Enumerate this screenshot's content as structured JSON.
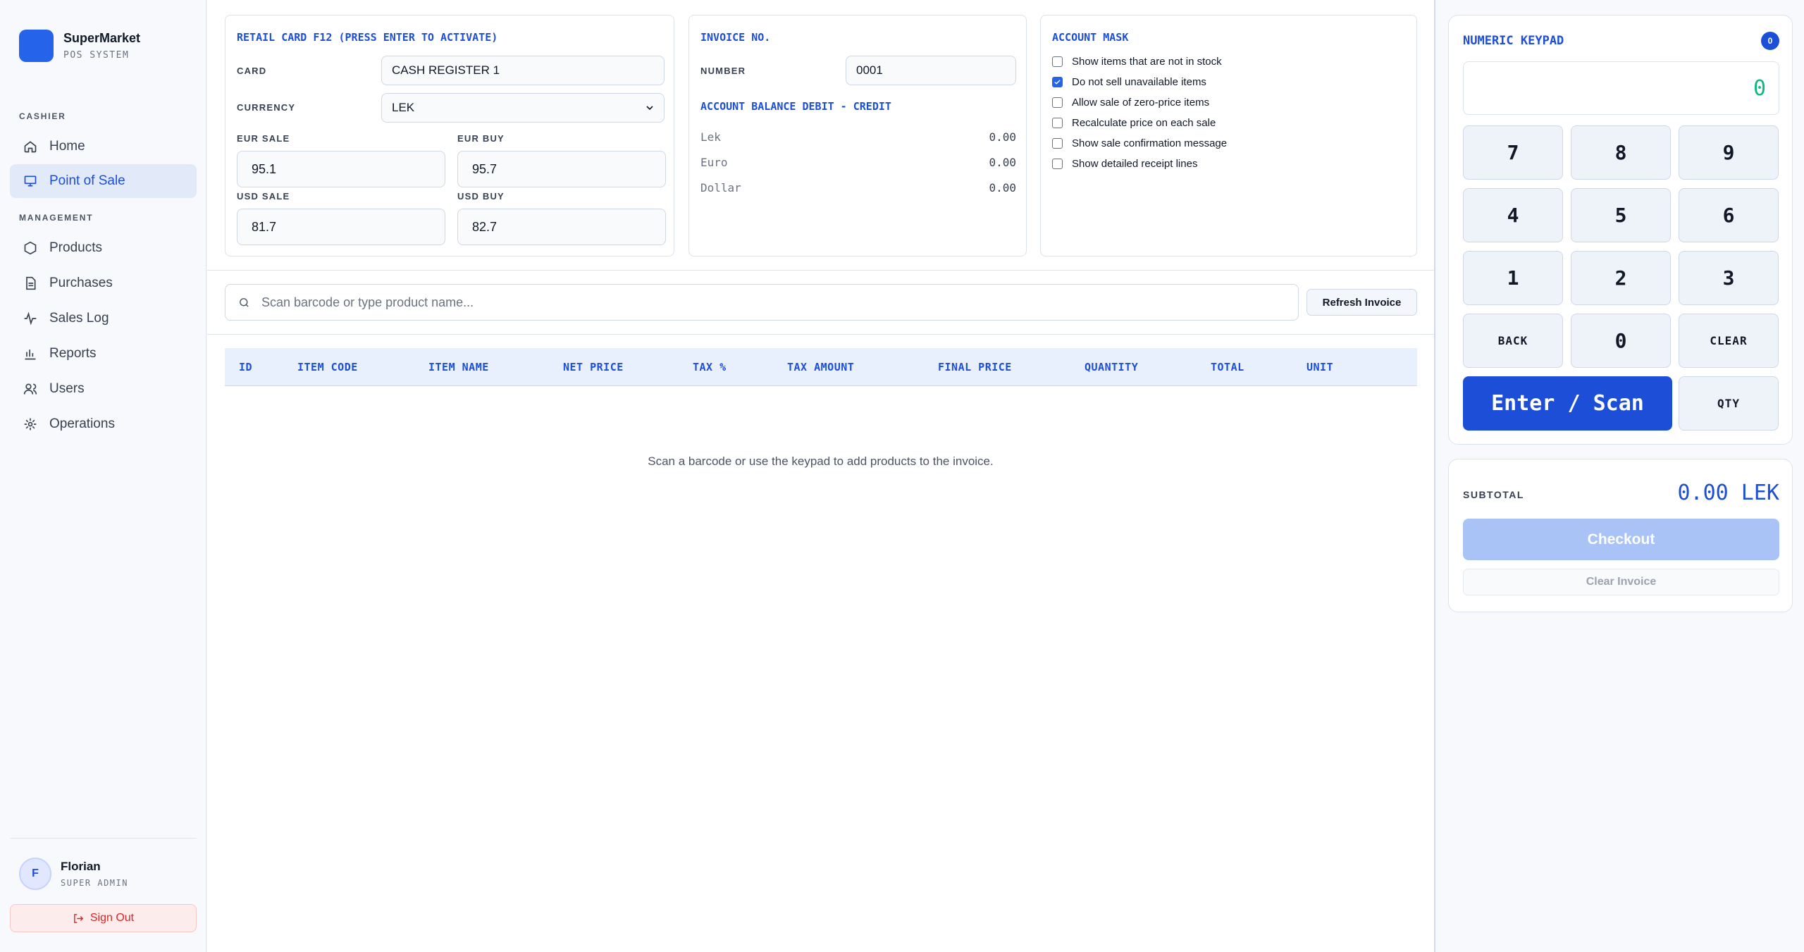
{
  "brand": {
    "name": "SuperMarket",
    "subtitle": "POS SYSTEM"
  },
  "sidebar": {
    "cashier_section": "CASHIER",
    "management_section": "MANAGEMENT",
    "items": [
      {
        "label": "Home",
        "icon": "home-icon"
      },
      {
        "label": "Point of Sale",
        "icon": "monitor-icon",
        "active": true
      },
      {
        "label": "Products",
        "icon": "box-icon"
      },
      {
        "label": "Purchases",
        "icon": "document-icon"
      },
      {
        "label": "Sales Log",
        "icon": "activity-icon"
      },
      {
        "label": "Reports",
        "icon": "bar-chart-icon"
      },
      {
        "label": "Users",
        "icon": "users-icon"
      },
      {
        "label": "Operations",
        "icon": "sun-icon"
      }
    ],
    "user": {
      "initial": "F",
      "name": "Florian",
      "role": "SUPER ADMIN"
    },
    "sign_out": "Sign Out"
  },
  "retail_card": {
    "title": "RETAIL CARD F12 (PRESS ENTER TO ACTIVATE)",
    "card_label": "CARD",
    "card_value": "CASH REGISTER 1",
    "currency_label": "CURRENCY",
    "currency_value": "LEK",
    "eur_sale_label": "EUR SALE",
    "eur_sale": "95.1",
    "eur_buy_label": "EUR BUY",
    "eur_buy": "95.7",
    "usd_sale_label": "USD SALE",
    "usd_sale": "81.7",
    "usd_buy_label": "USD BUY",
    "usd_buy": "82.7"
  },
  "invoice": {
    "title": "INVOICE NO.",
    "number_label": "NUMBER",
    "number_value": "0001",
    "balance_title": "ACCOUNT BALANCE DEBIT - CREDIT",
    "balances": [
      {
        "name": "Lek",
        "value": "0.00"
      },
      {
        "name": "Euro",
        "value": "0.00"
      },
      {
        "name": "Dollar",
        "value": "0.00"
      }
    ]
  },
  "account_mask": {
    "title": "ACCOUNT MASK",
    "options": [
      {
        "label": "Show items that are not in stock",
        "checked": false
      },
      {
        "label": "Do not sell unavailable items",
        "checked": true
      },
      {
        "label": "Allow sale of zero-price items",
        "checked": false
      },
      {
        "label": "Recalculate price on each sale",
        "checked": false
      },
      {
        "label": "Show sale confirmation message",
        "checked": false
      },
      {
        "label": "Show detailed receipt lines",
        "checked": false
      }
    ]
  },
  "search": {
    "placeholder": "Scan barcode or type product name...",
    "refresh_label": "Refresh Invoice"
  },
  "table": {
    "columns": [
      "ID",
      "ITEM CODE",
      "ITEM NAME",
      "NET PRICE",
      "TAX %",
      "TAX AMOUNT",
      "FINAL PRICE",
      "QUANTITY",
      "TOTAL",
      "UNIT"
    ],
    "empty_message": "Scan a barcode or use the keypad to add products to the invoice."
  },
  "keypad": {
    "title": "NUMERIC KEYPAD",
    "badge": "0",
    "display": "0",
    "keys": [
      "7",
      "8",
      "9",
      "4",
      "5",
      "6",
      "1",
      "2",
      "3",
      "BACK",
      "0",
      "CLEAR"
    ],
    "enter_label": "Enter / Scan",
    "qty_label": "QTY"
  },
  "summary": {
    "subtotal_label": "SUBTOTAL",
    "subtotal_value": "0.00 LEK",
    "checkout_label": "Checkout",
    "clear_label": "Clear Invoice"
  },
  "colors": {
    "accent": "#1d4ed8",
    "brand": "#2563eb",
    "display_text": "#10b981",
    "danger": "#dc2626"
  }
}
